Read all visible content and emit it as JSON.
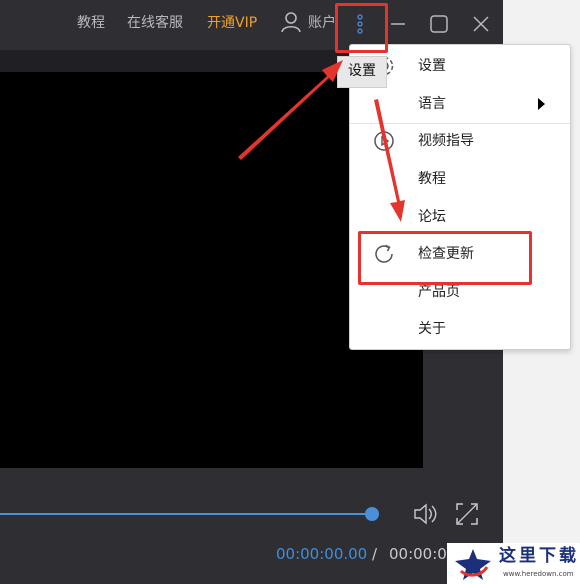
{
  "titlebar": {
    "nav": [
      "教程",
      "在线客服"
    ],
    "vip": "开通VIP",
    "account": "账户",
    "icons": {
      "user": "user-icon",
      "more": "more-vertical-icon",
      "minimize": "minimize-icon",
      "maximize": "maximize-icon",
      "close": "close-icon"
    }
  },
  "tooltip": "设置",
  "menu": {
    "items": [
      {
        "label": "设置",
        "icon": "gear-icon"
      },
      {
        "label": "语言",
        "icon": "",
        "submenu": true
      },
      {
        "label": "视频指导",
        "icon": "play-circle-icon"
      },
      {
        "label": "教程",
        "icon": ""
      },
      {
        "label": "论坛",
        "icon": ""
      },
      {
        "label": "检查更新",
        "icon": "refresh-icon"
      },
      {
        "label": "产品页",
        "icon": ""
      },
      {
        "label": "关于",
        "icon": ""
      }
    ]
  },
  "player": {
    "current_time": "00:00:00.00",
    "separator": "/",
    "total_time": "00:00:00",
    "progress": 1.0,
    "icons": {
      "volume": "volume-icon",
      "fullscreen": "fullscreen-icon"
    }
  },
  "watermark": {
    "text": "这里下载",
    "url": "www.heredown.com"
  },
  "colors": {
    "accent": "#4a90d9",
    "vip": "#f0a12d",
    "highlight": "#e5342e",
    "titlebar_bg": "#2e2e33"
  }
}
